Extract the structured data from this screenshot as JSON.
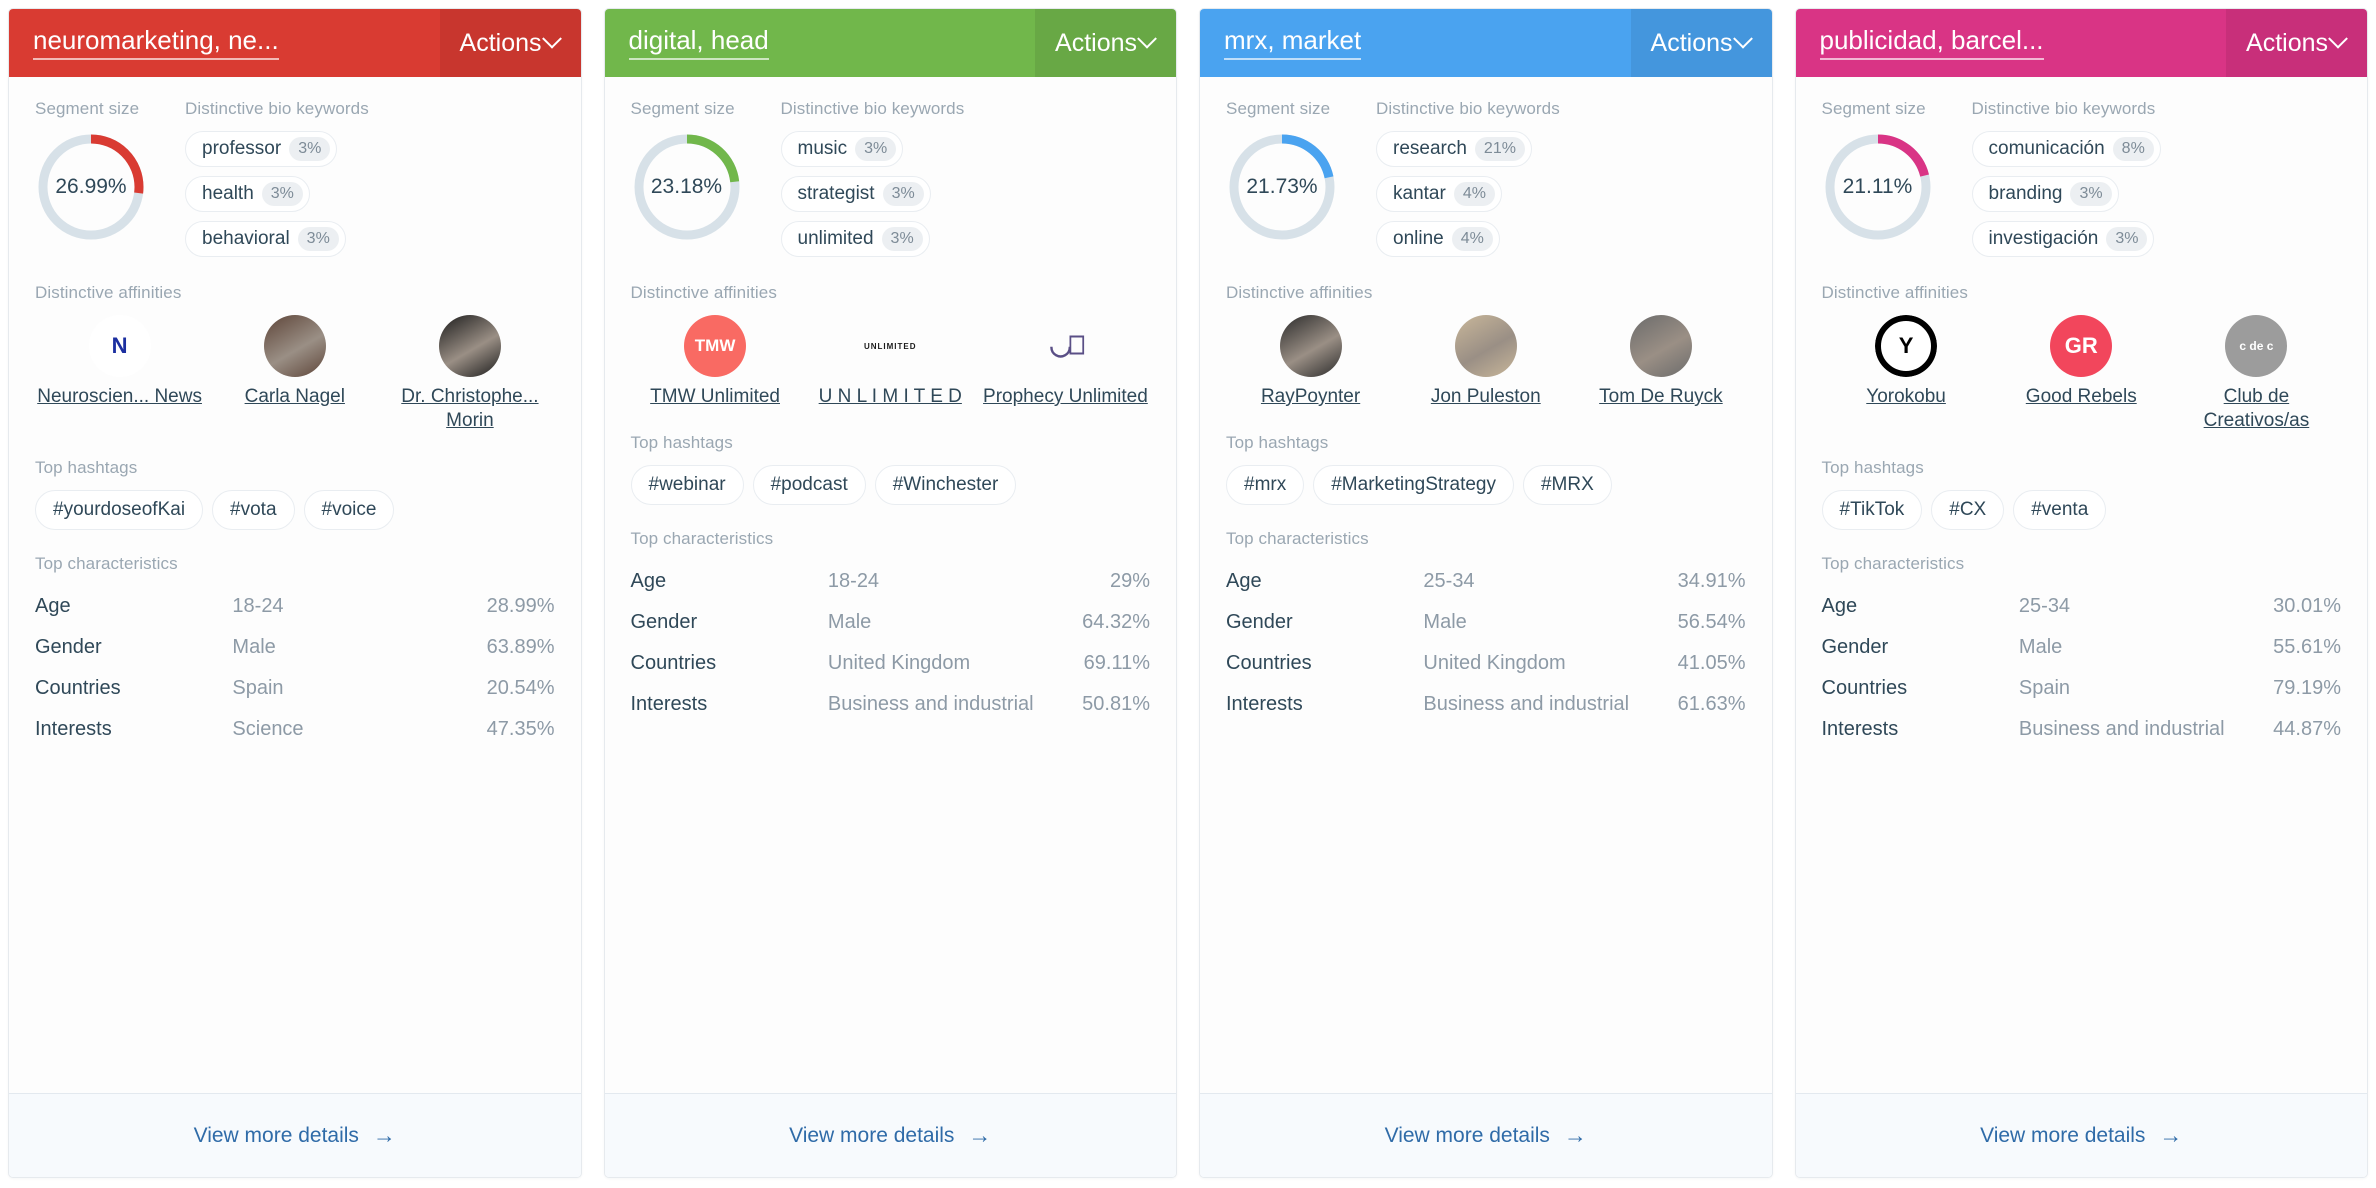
{
  "labels": {
    "actions": "Actions",
    "segment_size": "Segment size",
    "bio_keywords": "Distinctive bio keywords",
    "affinities": "Distinctive affinities",
    "hashtags": "Top hashtags",
    "characteristics": "Top characteristics",
    "view_more": "View more details",
    "arrow": "→",
    "chevron": "chevron-down-icon"
  },
  "cards": [
    {
      "title": "neuromarketing, ne...",
      "color": "#d93b32",
      "segment_size": "26.99%",
      "segment_pct": 26.99,
      "keywords": [
        {
          "name": "professor",
          "pct": "3%"
        },
        {
          "name": "health",
          "pct": "3%"
        },
        {
          "name": "behavioral",
          "pct": "3%"
        }
      ],
      "affinities": [
        {
          "name": "Neuroscien... News",
          "logo_text": "N",
          "bg": "#ffffff",
          "fg": "#1c2fa0",
          "type": "logo"
        },
        {
          "name": "Carla Nagel",
          "logo_text": "",
          "bg": "#5d4438",
          "fg": "#ffffff",
          "type": "photo"
        },
        {
          "name": "Dr. Christophe... Morin",
          "logo_text": "",
          "bg": "#1b1b1b",
          "fg": "#ffffff",
          "type": "photo"
        }
      ],
      "hashtags": [
        "#yourdoseofKai",
        "#vota",
        "#voice"
      ],
      "characteristics": [
        {
          "key": "Age",
          "value": "18-24",
          "pct": "28.99%"
        },
        {
          "key": "Gender",
          "value": "Male",
          "pct": "63.89%"
        },
        {
          "key": "Countries",
          "value": "Spain",
          "pct": "20.54%"
        },
        {
          "key": "Interests",
          "value": "Science",
          "pct": "47.35%"
        }
      ]
    },
    {
      "title": "digital, head",
      "color": "#71b74b",
      "segment_size": "23.18%",
      "segment_pct": 23.18,
      "keywords": [
        {
          "name": "music",
          "pct": "3%"
        },
        {
          "name": "strategist",
          "pct": "3%"
        },
        {
          "name": "unlimited",
          "pct": "3%"
        }
      ],
      "affinities": [
        {
          "name": "TMW Unlimited",
          "logo_text": "TMW",
          "bg": "#f96a63",
          "fg": "#ffffff",
          "type": "logo"
        },
        {
          "name": "U N L I M I T E D",
          "logo_text": "UNLIMITED",
          "bg": "#fdfdfd",
          "fg": "#1b1b1b",
          "type": "logo"
        },
        {
          "name": "Prophecy Unlimited",
          "logo_text": "PU",
          "bg": "#fdfdfd",
          "fg": "#5a4f86",
          "type": "logo"
        }
      ],
      "hashtags": [
        "#webinar",
        "#podcast",
        "#Winchester"
      ],
      "characteristics": [
        {
          "key": "Age",
          "value": "18-24",
          "pct": "29%"
        },
        {
          "key": "Gender",
          "value": "Male",
          "pct": "64.32%"
        },
        {
          "key": "Countries",
          "value": "United Kingdom",
          "pct": "69.11%"
        },
        {
          "key": "Interests",
          "value": "Business and industrial",
          "pct": "50.81%"
        }
      ]
    },
    {
      "title": "mrx, market",
      "color": "#4aa3f0",
      "segment_size": "21.73%",
      "segment_pct": 21.73,
      "keywords": [
        {
          "name": "research",
          "pct": "21%"
        },
        {
          "name": "kantar",
          "pct": "4%"
        },
        {
          "name": "online",
          "pct": "4%"
        }
      ],
      "affinities": [
        {
          "name": "RayPoynter",
          "logo_text": "",
          "bg": "#2a2a2a",
          "fg": "#ffffff",
          "type": "photo"
        },
        {
          "name": "Jon Puleston",
          "logo_text": "",
          "bg": "#c9b79a",
          "fg": "#ffffff",
          "type": "photo"
        },
        {
          "name": "Tom De Ruyck",
          "logo_text": "",
          "bg": "#6b6b6b",
          "fg": "#ffffff",
          "type": "photo"
        }
      ],
      "hashtags": [
        "#mrx",
        "#MarketingStrategy",
        "#MRX"
      ],
      "characteristics": [
        {
          "key": "Age",
          "value": "25-34",
          "pct": "34.91%"
        },
        {
          "key": "Gender",
          "value": "Male",
          "pct": "56.54%"
        },
        {
          "key": "Countries",
          "value": "United Kingdom",
          "pct": "41.05%"
        },
        {
          "key": "Interests",
          "value": "Business and industrial",
          "pct": "61.63%"
        }
      ]
    },
    {
      "title": "publicidad, barcel...",
      "color": "#d93485",
      "segment_size": "21.11%",
      "segment_pct": 21.11,
      "keywords": [
        {
          "name": "comunicación",
          "pct": "8%"
        },
        {
          "name": "branding",
          "pct": "3%"
        },
        {
          "name": "investigación",
          "pct": "3%"
        }
      ],
      "affinities": [
        {
          "name": "Yorokobu",
          "logo_text": "Y",
          "bg": "#ffffff",
          "fg": "#000000",
          "type": "logo"
        },
        {
          "name": "Good Rebels",
          "logo_text": "GR",
          "bg": "#f2465c",
          "fg": "#ffffff",
          "type": "logo"
        },
        {
          "name": "Club de Creativos/as",
          "logo_text": "c de c",
          "bg": "#9c9c9c",
          "fg": "#ffffff",
          "type": "logo"
        }
      ],
      "hashtags": [
        "#TikTok",
        "#CX",
        "#venta"
      ],
      "characteristics": [
        {
          "key": "Age",
          "value": "25-34",
          "pct": "30.01%"
        },
        {
          "key": "Gender",
          "value": "Male",
          "pct": "55.61%"
        },
        {
          "key": "Countries",
          "value": "Spain",
          "pct": "79.19%"
        },
        {
          "key": "Interests",
          "value": "Business and industrial",
          "pct": "44.87%"
        }
      ]
    }
  ]
}
